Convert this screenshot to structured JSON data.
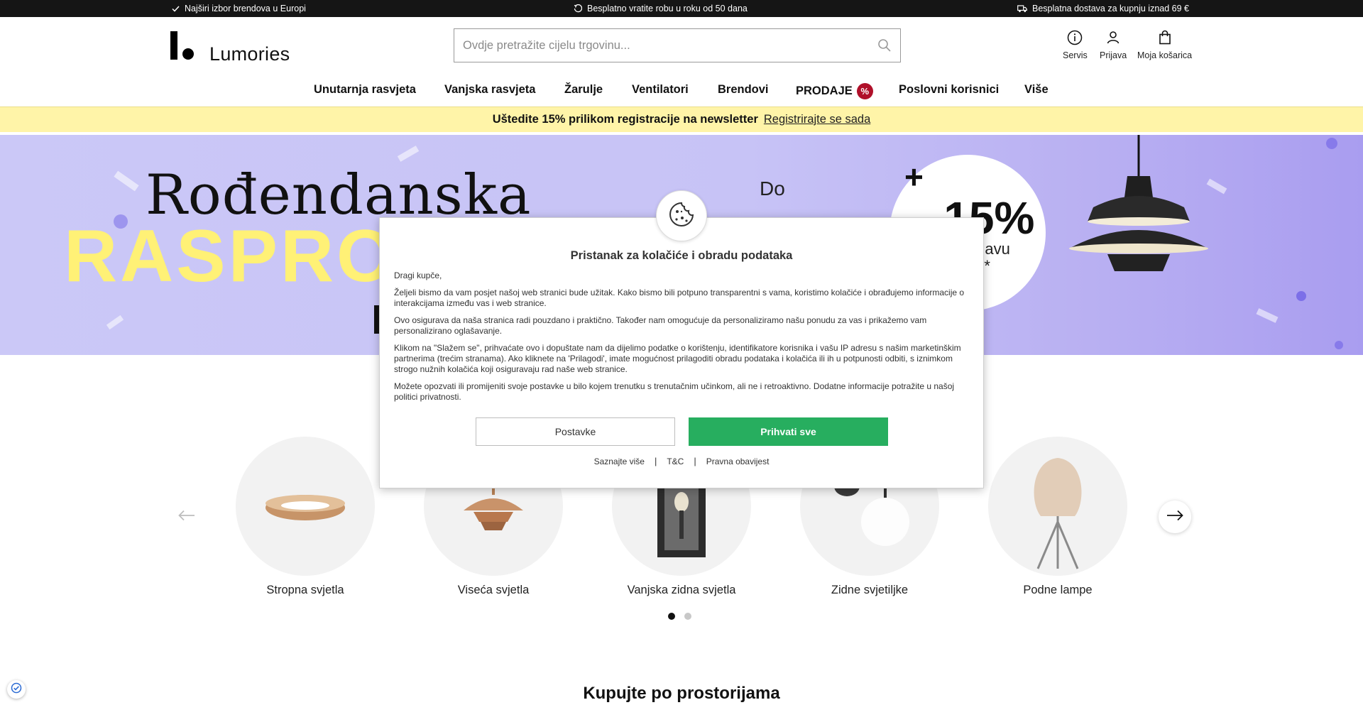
{
  "topbar": {
    "items": [
      {
        "icon": "check-icon",
        "text": "Najširi izbor brendova u Europi"
      },
      {
        "icon": "return-icon",
        "text": "Besplatno vratite robu u roku od 50 dana"
      },
      {
        "icon": "truck-icon",
        "text": "Besplatna dostava za kupnju iznad 69 €"
      }
    ]
  },
  "header": {
    "logo_text": "Lumories",
    "search_placeholder": "Ovdje pretražite cijelu trgovinu...",
    "actions": {
      "service": "Servis",
      "login": "Prijava",
      "cart": "Moja košarica"
    }
  },
  "nav": {
    "items": [
      "Unutarnja rasvjeta",
      "Vanjska rasvjeta",
      "Žarulje",
      "Ventilatori",
      "Brendovi",
      "PRODAJE",
      "Poslovni korisnici",
      "Više"
    ],
    "sale_badge": "%"
  },
  "newsletter": {
    "text": "Uštedite 15% prilikom registracije na newsletter",
    "link": "Registrirajte se sada"
  },
  "hero": {
    "line1": "Rođendanska",
    "line2": "RASPRO",
    "do": "Do",
    "plus": "+",
    "percent": "-15%",
    "sub1": "prijavu",
    "sub2": "tter**",
    "colors": {
      "background": "#c9c5f7",
      "accent_text": "#fff176"
    }
  },
  "cookie": {
    "title": "Pristanak za kolačiće i obradu podataka",
    "greeting": "Dragi kupče,",
    "p1": "Željeli bismo da vam posjet našoj web stranici bude užitak. Kako bismo bili potpuno transparentni s vama, koristimo kolačiće i obrađujemo informacije o interakcijama između vas i web stranice.",
    "p2": "Ovo osigurava da naša stranica radi pouzdano i praktično. Također nam omogućuje da personaliziramo našu ponudu za vas i prikažemo vam personalizirano oglašavanje.",
    "p3": "Klikom na \"Slažem se\", prihvaćate ovo i dopuštate nam da dijelimo podatke o korištenju, identifikatore korisnika i vašu IP adresu s našim marketinškim partnerima (trećim stranama). Ako kliknete na 'Prilagodi', imate mogućnost prilagoditi obradu podataka i kolačića ili ih u potpunosti odbiti, s iznimkom strogo nužnih kolačića koji osiguravaju rad naše web stranice.",
    "p4": "Možete opozvati ili promijeniti svoje postavke u bilo kojem trenutku s trenutačnim učinkom, ali ne i retroaktivno. Dodatne informacije potražite u našoj politici privatnosti.",
    "btn_settings": "Postavke",
    "btn_accept": "Prihvati sve",
    "links": [
      "Saznajte više",
      "T&C",
      "Pravna obavijest"
    ],
    "separator": "|",
    "accept_color": "#27ae5f"
  },
  "categories": {
    "items": [
      "Stropna svjetla",
      "Viseća svjetla",
      "Vanjska zidna svjetla",
      "Zidne svjetiljke",
      "Podne lampe"
    ],
    "pages": 2,
    "current_page": 1
  },
  "rooms_title": "Kupujte po prostorijama"
}
